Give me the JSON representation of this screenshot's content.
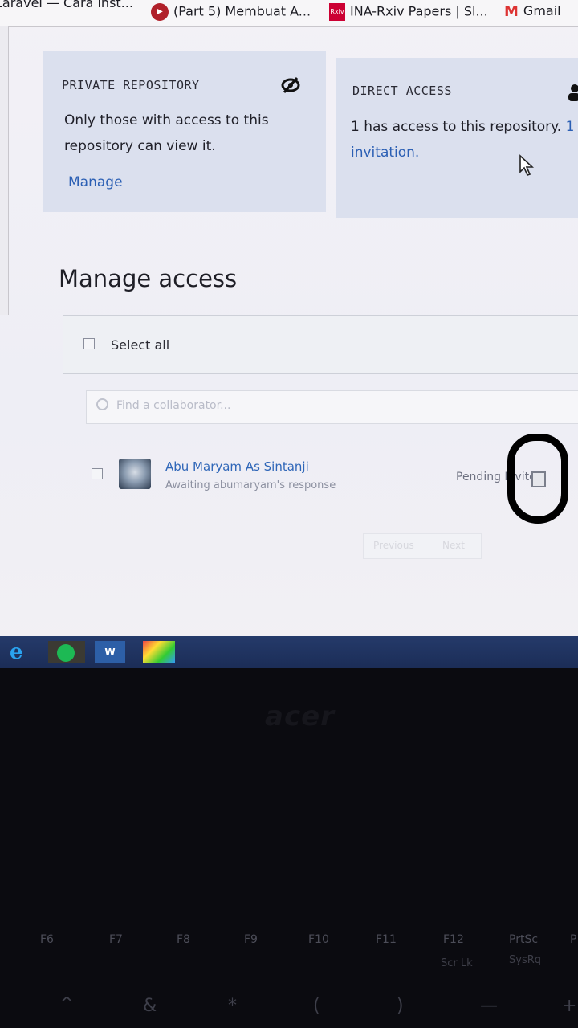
{
  "bookmarks": [
    {
      "label": "Laravel — Cara inst...",
      "icon": "laravel-icon"
    },
    {
      "label": "(Part 5) Membuat A...",
      "icon": "video-icon"
    },
    {
      "label": "INA-Rxiv Papers | Sl...",
      "icon": "rxiv-icon"
    },
    {
      "label": "Gmail",
      "icon": "gmail-icon"
    }
  ],
  "private_card": {
    "title": "PRIVATE REPOSITORY",
    "line1": "Only those with access to this",
    "line2": "repository can view it.",
    "link": "Manage",
    "icon": "eye-slash-icon"
  },
  "direct_card": {
    "title": "DIRECT ACCESS",
    "line1_text": "1 has access to this repository.",
    "line1_link": "1",
    "line2_link": "invitation."
  },
  "manage_access": {
    "heading": "Manage access",
    "select_all": "Select all",
    "search_placeholder": "Find a collaborator..."
  },
  "collaborator": {
    "name": "Abu Maryam As Sintanji",
    "subtext": "Awaiting abumaryam's response",
    "status": "Pending Invite"
  },
  "pagination": {
    "prev": "Previous",
    "next": "Next"
  },
  "taskbar": [
    "edge-icon",
    "spotify-icon",
    "word-icon",
    "paint-icon"
  ],
  "keyboard": {
    "brand": "acer",
    "fkeys": [
      "F6",
      "F7",
      "F8",
      "F9",
      "F10",
      "F11",
      "F12",
      "PrtSc",
      "P"
    ],
    "fsubs": [
      "Scr Lk",
      "SysRq"
    ],
    "symbols": [
      "^",
      "&",
      "*",
      "(",
      ")",
      "—",
      "+"
    ]
  },
  "colors": {
    "link": "#2b5fb4",
    "card": "#dbe0ee",
    "taskbar": "#1b2d57"
  }
}
